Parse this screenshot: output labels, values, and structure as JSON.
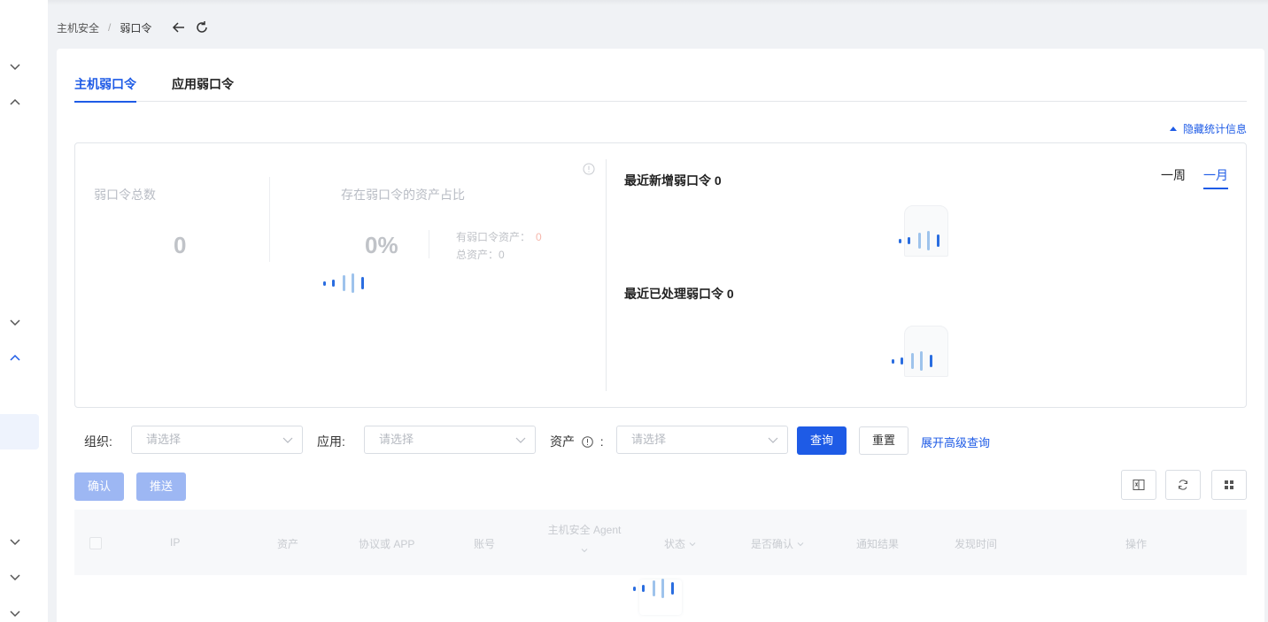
{
  "breadcrumb": {
    "parent": "主机安全",
    "separator": "/",
    "current": "弱口令"
  },
  "tabs": [
    {
      "label": "主机弱口令",
      "active": true
    },
    {
      "label": "应用弱口令",
      "active": false
    }
  ],
  "hide_stats_label": "隐藏统计信息",
  "stats": {
    "total_title": "弱口令总数",
    "total_value": "0",
    "ratio_title": "存在弱口令的资产占比",
    "ratio_value": "0%",
    "weak_assets_label": "有弱口令资产：",
    "weak_assets_value": "0",
    "total_assets_label": "总资产：",
    "total_assets_value": "0"
  },
  "recent": {
    "new_title": "最近新增弱口令 0",
    "handled_title": "最近已处理弱口令 0",
    "periods": [
      {
        "label": "一周",
        "active": false
      },
      {
        "label": "一月",
        "active": true
      }
    ]
  },
  "filters": {
    "org_label": "组织:",
    "org_placeholder": "请选择",
    "app_label": "应用:",
    "app_placeholder": "请选择",
    "asset_label": "资产",
    "asset_colon": ":",
    "asset_placeholder": "请选择",
    "query_button": "查询",
    "reset_button": "重置",
    "advanced_link": "展开高级查询"
  },
  "actions": {
    "confirm_button": "确认",
    "push_button": "推送"
  },
  "table": {
    "columns": {
      "ip": "IP",
      "asset": "资产",
      "protocol": "协议或 APP",
      "account": "账号",
      "agent": "主机安全 Agent",
      "status": "状态",
      "confirmed": "是否确认",
      "notify": "通知结果",
      "found_time": "发现时间",
      "operation": "操作"
    }
  },
  "colors": {
    "primary": "#1e5be6",
    "loader_light": "#9ec3ec",
    "loader_dark": "#2a6de0"
  },
  "icons": {
    "sidebar": [
      "chevron-down-icon",
      "chevron-up-icon",
      "chevron-down-icon",
      "chevron-up-icon",
      "chevron-down-icon",
      "chevron-down-icon",
      "chevron-down-icon"
    ],
    "toolbar": [
      "export-excel-icon",
      "refresh-icon",
      "grid-icon"
    ]
  }
}
